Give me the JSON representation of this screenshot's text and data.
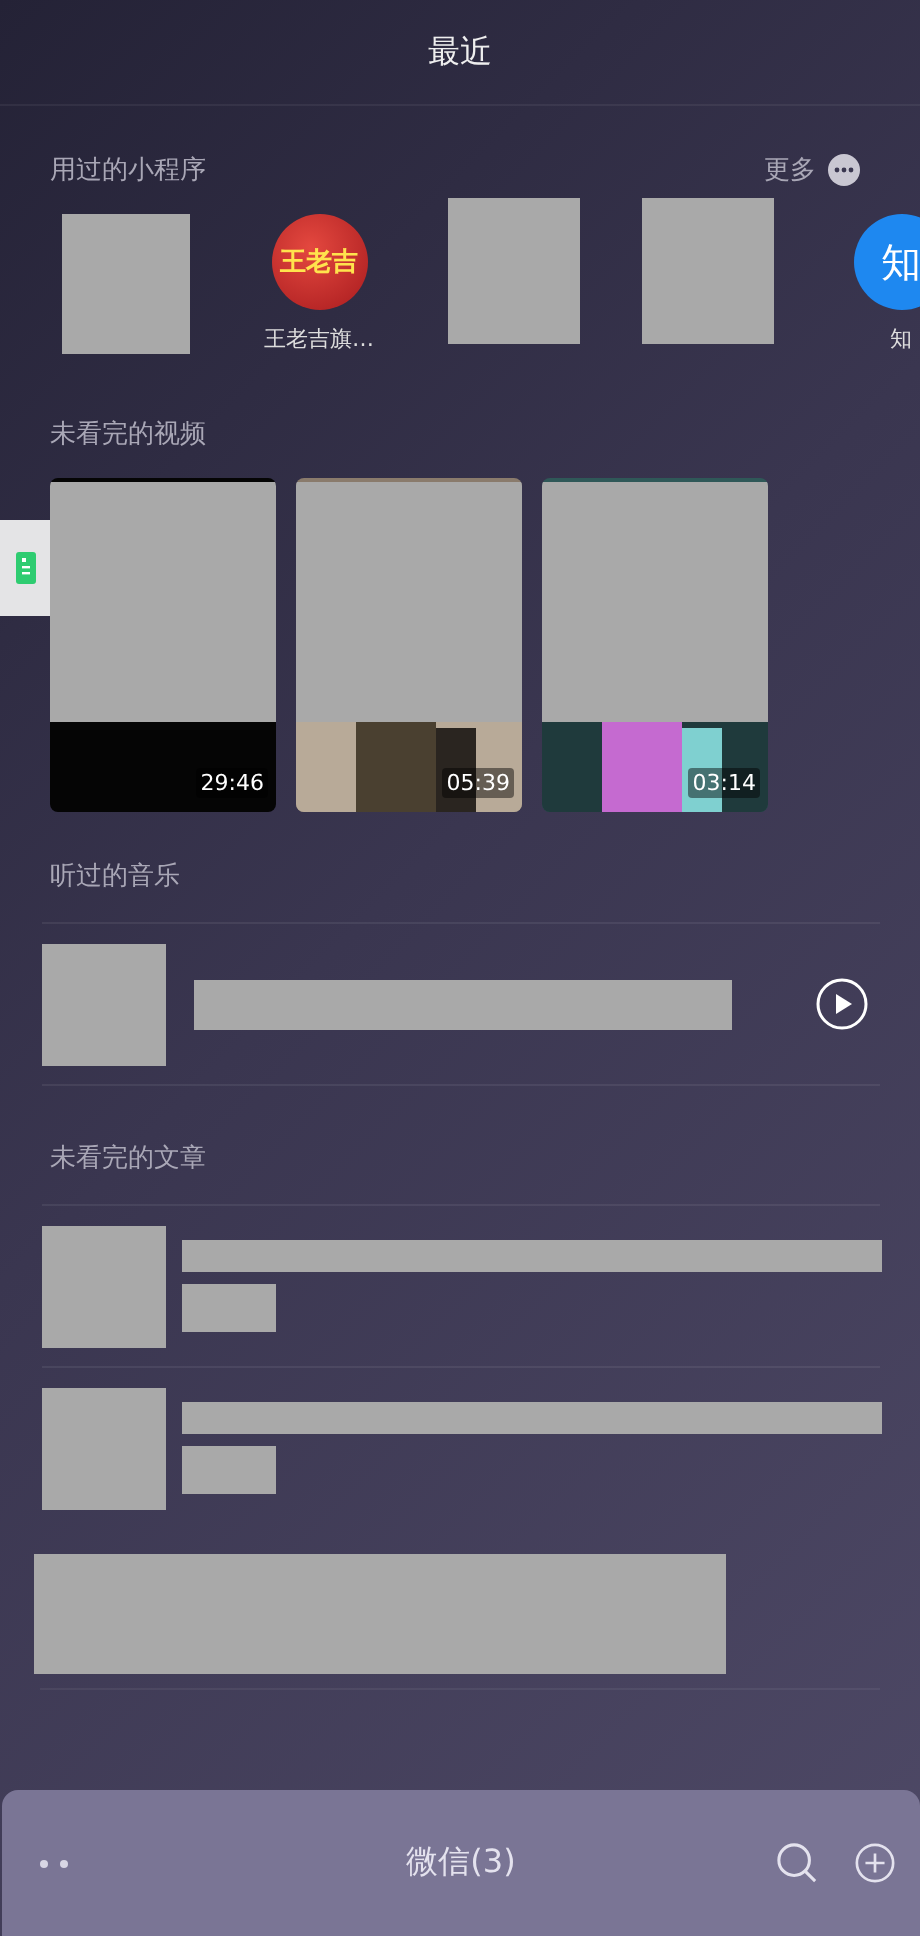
{
  "header": {
    "title": "最近"
  },
  "mini_programs": {
    "title": "用过的小程序",
    "more": "更多",
    "items": [
      {
        "kind": "redacted"
      },
      {
        "kind": "logo",
        "logo_text": "王老吉",
        "label": "王老吉旗…"
      },
      {
        "kind": "redacted"
      },
      {
        "kind": "redacted"
      },
      {
        "kind": "letter",
        "logo_text": "知",
        "label": "知"
      }
    ]
  },
  "videos": {
    "title": "未看完的视频",
    "items": [
      {
        "duration": "29:46"
      },
      {
        "duration": "05:39"
      },
      {
        "duration": "03:14"
      }
    ]
  },
  "music": {
    "title": "听过的音乐",
    "items": [
      {
        "kind": "redacted"
      }
    ]
  },
  "articles": {
    "title": "未看完的文章",
    "items": [
      {
        "kind": "redacted"
      },
      {
        "kind": "redacted"
      }
    ]
  },
  "bottom_bar": {
    "title": "微信(3)"
  }
}
